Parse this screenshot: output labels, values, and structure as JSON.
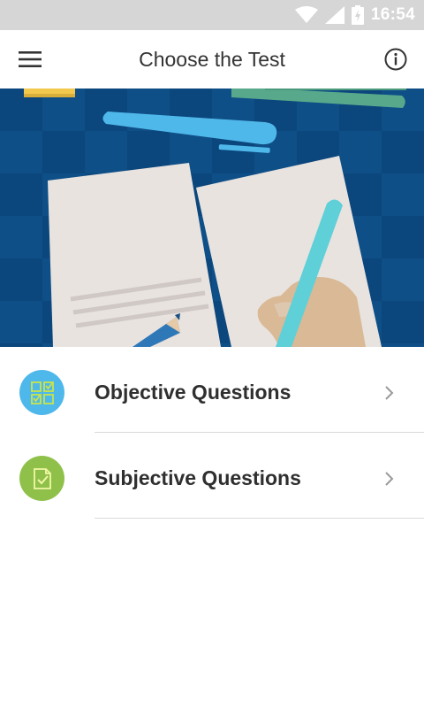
{
  "status_bar": {
    "time": "16:54",
    "icons": [
      "wifi-icon",
      "cell-signal-icon",
      "battery-icon"
    ]
  },
  "app_bar": {
    "title": "Choose the Test",
    "menu_icon": "hamburger-menu-icon",
    "info_icon": "info-icon"
  },
  "banner": {
    "illustration": "papers-pencil-pen-illustration",
    "background_color": "#0e4f86"
  },
  "list": {
    "items": [
      {
        "label": "Objective Questions",
        "icon": "grid-checkbox-icon",
        "icon_color": "#4fb8ea"
      },
      {
        "label": "Subjective Questions",
        "icon": "document-check-icon",
        "icon_color": "#8fc14a"
      }
    ]
  }
}
